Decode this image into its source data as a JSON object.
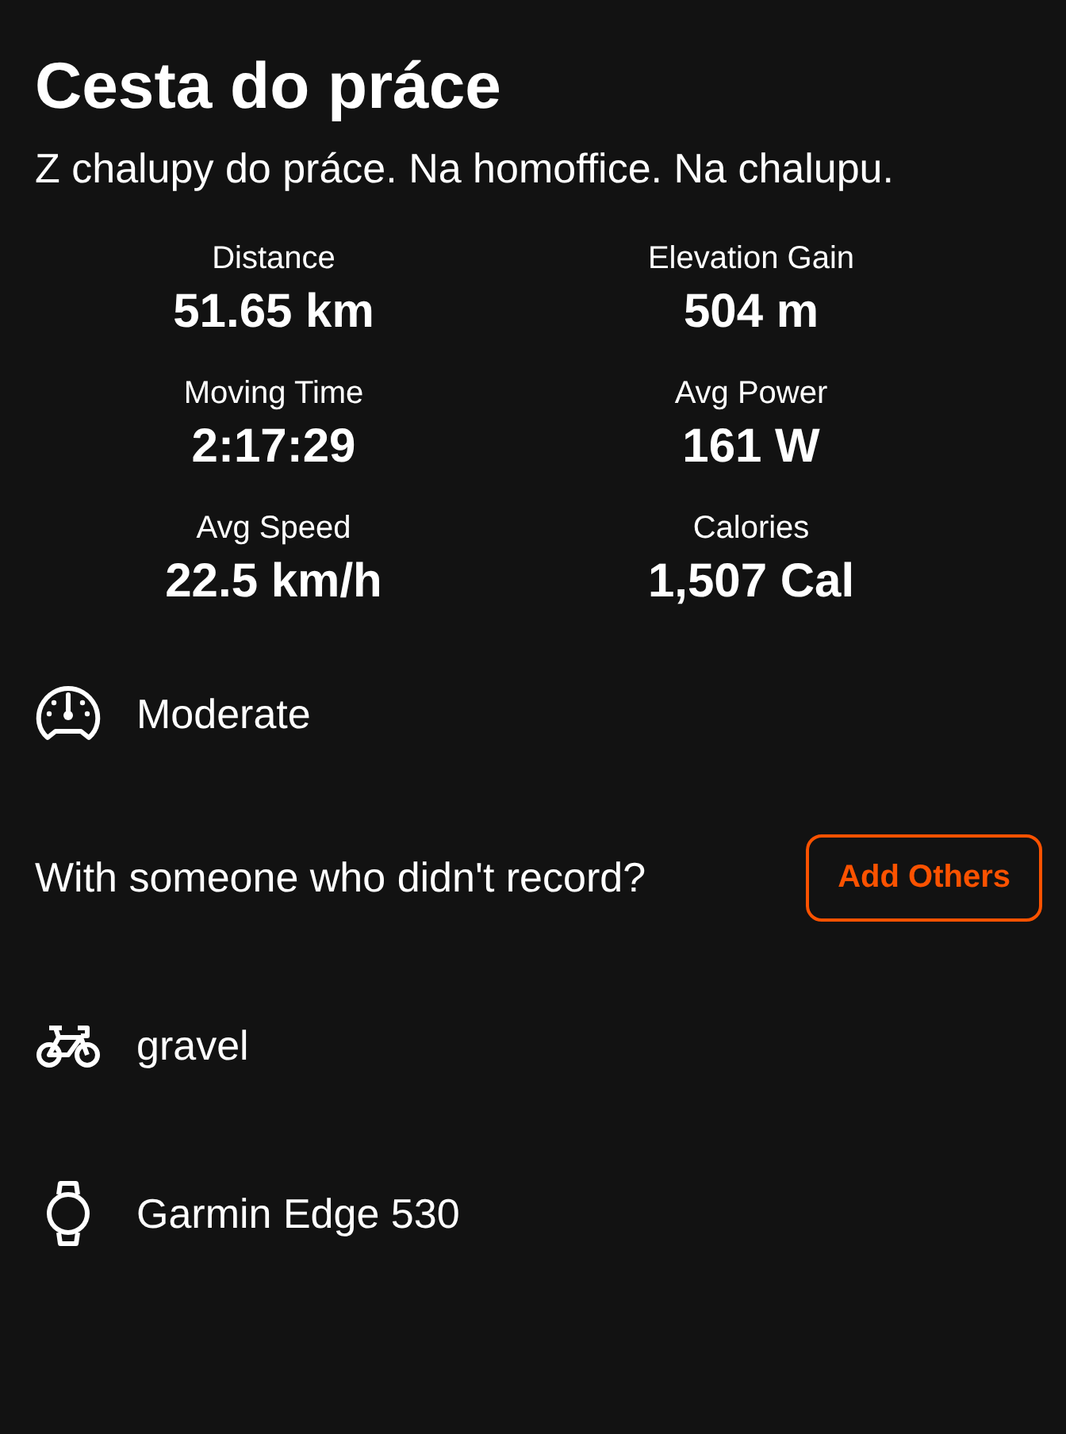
{
  "title": "Cesta do práce",
  "description": "Z chalupy do práce. Na homoffice. Na chalupu.",
  "stats": [
    {
      "label": "Distance",
      "value": "51.65 km"
    },
    {
      "label": "Elevation Gain",
      "value": "504 m"
    },
    {
      "label": "Moving Time",
      "value": "2:17:29"
    },
    {
      "label": "Avg Power",
      "value": "161 W"
    },
    {
      "label": "Avg Speed",
      "value": "22.5 km/h"
    },
    {
      "label": "Calories",
      "value": "1,507 Cal"
    }
  ],
  "details": [
    {
      "kind": "effort",
      "text": "Moderate"
    },
    {
      "kind": "prompt",
      "text": "With someone who didn't record?",
      "button": "Add Others"
    },
    {
      "kind": "bike",
      "text": "gravel"
    },
    {
      "kind": "device",
      "text": "Garmin Edge 530"
    }
  ]
}
